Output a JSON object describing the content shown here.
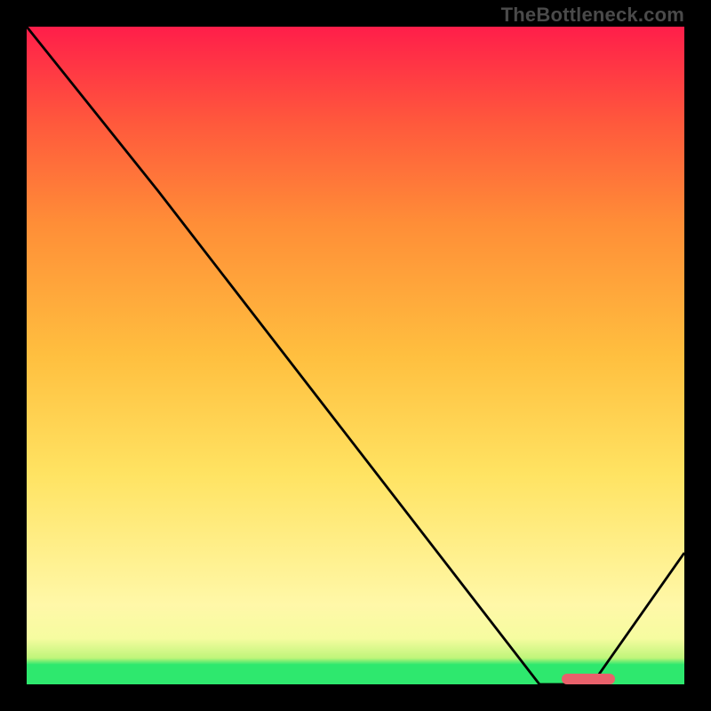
{
  "watermark": "TheBottleneck.com",
  "chart_data": {
    "type": "line",
    "title": "",
    "xlabel": "",
    "ylabel": "",
    "xlim": [
      0,
      100
    ],
    "ylim": [
      0,
      100
    ],
    "grid": false,
    "legend": false,
    "x": [
      0,
      20,
      78,
      86,
      100
    ],
    "values": [
      100,
      75,
      0,
      0,
      20
    ],
    "annotations": [
      {
        "name": "marker",
        "x": 82,
        "y": 1.5,
        "color": "#e9616b"
      }
    ]
  }
}
